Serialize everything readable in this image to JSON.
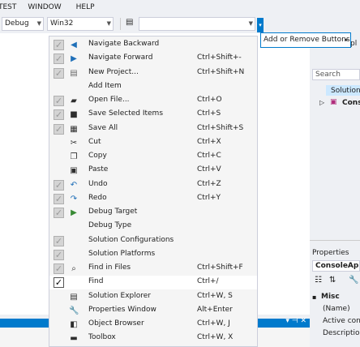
{
  "menubar": [
    "TEST",
    "WINDOW",
    "HELP"
  ],
  "toolbar": {
    "config_value": "Debug",
    "platform_value": "Win32",
    "search_value": ""
  },
  "tooltip": "Add or Remove Buttons",
  "menu": {
    "items": [
      {
        "label": "Navigate Backward",
        "shortcut": "",
        "checked": true,
        "icon": "navigate-backward-icon",
        "glyph": "◀",
        "color": "#1f6fb8"
      },
      {
        "label": "Navigate Forward",
        "shortcut": "Ctrl+Shift+-",
        "checked": true,
        "icon": "navigate-forward-icon",
        "glyph": "▶",
        "color": "#1f6fb8"
      },
      {
        "label": "New Project...",
        "shortcut": "Ctrl+Shift+N",
        "checked": true,
        "icon": "new-project-icon",
        "glyph": "▤",
        "color": "#6a6a6a"
      },
      {
        "label": "Add Item",
        "shortcut": "",
        "checked": false,
        "icon": "",
        "glyph": "",
        "color": ""
      },
      {
        "label": "Open File...",
        "shortcut": "Ctrl+O",
        "checked": true,
        "icon": "open-file-icon",
        "glyph": "▰",
        "color": "#2e2e2e"
      },
      {
        "label": "Save Selected Items",
        "shortcut": "Ctrl+S",
        "checked": true,
        "icon": "save-icon",
        "glyph": "■",
        "color": "#2e2e2e"
      },
      {
        "label": "Save All",
        "shortcut": "Ctrl+Shift+S",
        "checked": true,
        "icon": "save-all-icon",
        "glyph": "▦",
        "color": "#2e2e2e"
      },
      {
        "label": "Cut",
        "shortcut": "Ctrl+X",
        "checked": false,
        "icon": "cut-icon",
        "glyph": "✂",
        "color": "#2e2e2e"
      },
      {
        "label": "Copy",
        "shortcut": "Ctrl+C",
        "checked": false,
        "icon": "copy-icon",
        "glyph": "❐",
        "color": "#2e2e2e"
      },
      {
        "label": "Paste",
        "shortcut": "Ctrl+V",
        "checked": false,
        "icon": "paste-icon",
        "glyph": "▣",
        "color": "#2e2e2e"
      },
      {
        "label": "Undo",
        "shortcut": "Ctrl+Z",
        "checked": true,
        "icon": "undo-icon",
        "glyph": "↶",
        "color": "#1f6fb8"
      },
      {
        "label": "Redo",
        "shortcut": "Ctrl+Y",
        "checked": true,
        "icon": "redo-icon",
        "glyph": "↷",
        "color": "#1f6fb8"
      },
      {
        "label": "Debug Target",
        "shortcut": "",
        "checked": true,
        "icon": "play-icon",
        "glyph": "▶",
        "color": "#388a34"
      },
      {
        "label": "Debug Type",
        "shortcut": "",
        "checked": false,
        "icon": "",
        "glyph": "",
        "color": ""
      },
      {
        "label": "Solution Configurations",
        "shortcut": "",
        "checked": true,
        "icon": "",
        "glyph": "",
        "color": ""
      },
      {
        "label": "Solution Platforms",
        "shortcut": "",
        "checked": true,
        "icon": "",
        "glyph": "",
        "color": ""
      },
      {
        "label": "Find in Files",
        "shortcut": "Ctrl+Shift+F",
        "checked": true,
        "icon": "find-in-files-icon",
        "glyph": "⌕",
        "color": "#2e2e2e"
      },
      {
        "label": "Find",
        "shortcut": "Ctrl+/",
        "checked": true,
        "active": true,
        "icon": "",
        "glyph": "",
        "color": ""
      },
      {
        "label": "Solution Explorer",
        "shortcut": "Ctrl+W, S",
        "checked": false,
        "icon": "solution-explorer-icon",
        "glyph": "▤",
        "color": "#2e2e2e"
      },
      {
        "label": "Properties Window",
        "shortcut": "Alt+Enter",
        "checked": false,
        "icon": "wrench-icon",
        "glyph": "🔧",
        "color": "#2e2e2e"
      },
      {
        "label": "Object Browser",
        "shortcut": "Ctrl+W, J",
        "checked": false,
        "icon": "object-browser-icon",
        "glyph": "◧",
        "color": "#2e2e2e"
      },
      {
        "label": "Toolbox",
        "shortcut": "Ctrl+W, X",
        "checked": false,
        "icon": "toolbox-icon",
        "glyph": "▬",
        "color": "#2e2e2e"
      }
    ]
  },
  "right_panel": {
    "top_fragment": "pl",
    "search_placeholder": "Search Solutio",
    "solution_label": "Solution",
    "console_label": "Cons",
    "properties_title": "Properties",
    "properties_object": "ConsoleAppl",
    "misc_label": "Misc",
    "rows": [
      "(Name)",
      "Active con",
      "Descriptio"
    ]
  }
}
